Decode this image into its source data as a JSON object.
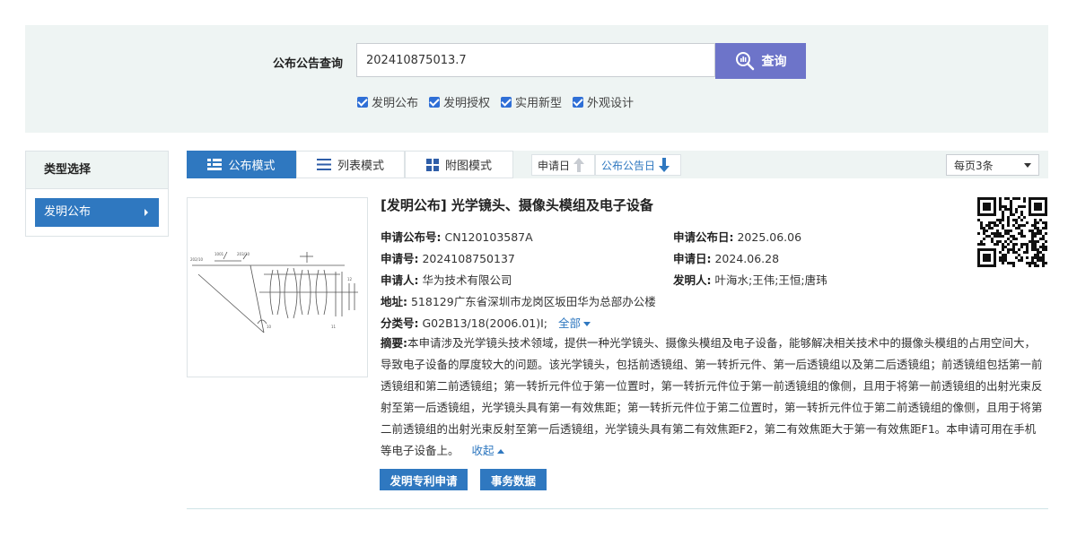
{
  "search": {
    "label": "公布公告查询",
    "value": "202410875013.7",
    "button_label": "查询",
    "checkboxes": [
      {
        "label": "发明公布",
        "checked": true
      },
      {
        "label": "发明授权",
        "checked": true
      },
      {
        "label": "实用新型",
        "checked": true
      },
      {
        "label": "外观设计",
        "checked": true
      }
    ]
  },
  "sidebar": {
    "title": "类型选择",
    "items": [
      {
        "label": "发明公布",
        "active": true
      }
    ]
  },
  "toolbar": {
    "modes": [
      {
        "label": "公布模式",
        "icon": "list-bullets-icon",
        "active": true
      },
      {
        "label": "列表模式",
        "icon": "lines-icon",
        "active": false
      },
      {
        "label": "附图模式",
        "icon": "grid-icon",
        "active": false
      }
    ],
    "sort": [
      {
        "label": "申请日",
        "direction": "up",
        "active": false
      },
      {
        "label": "公布公告日",
        "direction": "down",
        "active": true
      }
    ],
    "per_page": "每页3条"
  },
  "result": {
    "title": "[发明公布] 光学镜头、摄像头模组及电子设备",
    "pub_no_label": "申请公布号:",
    "pub_no": "CN120103587A",
    "pub_date_label": "申请公布日:",
    "pub_date": "2025.06.06",
    "app_no_label": "申请号:",
    "app_no": "2024108750137",
    "app_date_label": "申请日:",
    "app_date": "2024.06.28",
    "applicant_label": "申请人:",
    "applicant": "华为技术有限公司",
    "inventor_label": "发明人:",
    "inventor": "叶海水;王伟;王恒;唐玮",
    "address_label": "地址:",
    "address": "518129广东省深圳市龙岗区坂田华为总部办公楼",
    "class_label": "分类号:",
    "class_value": "G02B13/18(2006.01)I;",
    "class_all": "全部",
    "abstract_label": "摘要:",
    "abstract": "本申请涉及光学镜头技术领域，提供一种光学镜头、摄像头模组及电子设备，能够解决相关技术中的摄像头模组的占用空间大，导致电子设备的厚度较大的问题。该光学镜头，包括前透镜组、第一转折元件、第一后透镜组以及第二后透镜组；前透镜组包括第一前透镜组和第二前透镜组；第一转折元件位于第一位置时，第一转折元件位于第一前透镜组的像侧，且用于将第一前透镜组的出射光束反射至第一后透镜组，光学镜头具有第一有效焦距；第一转折元件位于第二位置时，第一转折元件位于第二前透镜组的像侧，且用于将第二前透镜组的出射光束反射至第一后透镜组，光学镜头具有第二有效焦距F2，第二有效焦距大于第一有效焦距F1。本申请可用在手机等电子设备上。",
    "collapse_label": "收起",
    "buttons": [
      "发明专利申请",
      "事务数据"
    ]
  },
  "colors": {
    "primary": "#2f78c0",
    "search_button": "#6d74c9",
    "panel_bg": "#eef4f3"
  }
}
